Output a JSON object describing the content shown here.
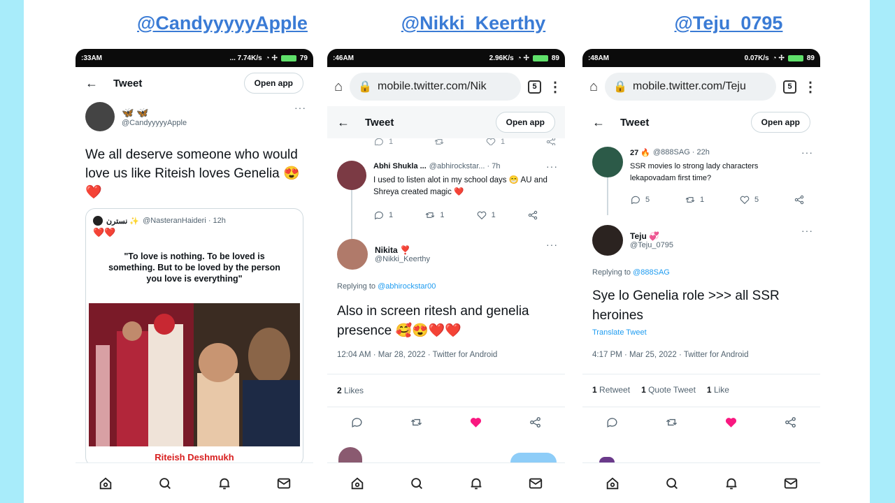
{
  "columns": [
    {
      "title": "@CandyyyyyApple",
      "status": {
        "time": ":33AM",
        "right": "... 7.74K/s",
        "battery": "79"
      },
      "header": {
        "title": "Tweet",
        "open_app": "Open app"
      },
      "author": {
        "name": "🦋 🦋",
        "handle": "@CandyyyyyApple"
      },
      "tweet_text": "We all deserve someone who would love us like Riteish loves Genelia 😍❤️",
      "quote": {
        "name": "نسترن ✨",
        "handle": "@NasteranHaideri · 12h",
        "hearts": "❤️❤️",
        "caption": "\"To love is nothing. To be loved is something. But to be loved by the person you love is everything\"",
        "footer": "Riteish Deshmukh"
      }
    },
    {
      "title": "@Nikki_Keerthy",
      "status": {
        "time": ":46AM",
        "right": "2.96K/s",
        "battery": "89"
      },
      "url": "mobile.twitter.com/Nik",
      "tab_count": "5",
      "header": {
        "title": "Tweet",
        "open_app": "Open app"
      },
      "prev_counts": [
        "1",
        "",
        "1",
        ""
      ],
      "reply": {
        "name": "Abhi Shukla ...",
        "handle": "@abhirockstar... · 7h",
        "text": "I used to listen alot in my school days 😁 AU and Shreya created magic ❤️",
        "counts": [
          "1",
          "1",
          "1"
        ]
      },
      "author": {
        "name": "Nikita ❣️",
        "handle": "@Nikki_Keerthy"
      },
      "replying_label": "Replying to ",
      "replying_to": "@abhirockstar00",
      "tweet_text": "Also in screen ritesh and genelia presence 🥰😍❤️❤️",
      "timestamp": "12:04 AM · Mar 28, 2022 · Twitter for Android",
      "stats": {
        "likes_count": "2",
        "likes_label": "Likes"
      }
    },
    {
      "title": "@Teju_0795",
      "status": {
        "time": ":48AM",
        "right": "0.07K/s",
        "battery": "89"
      },
      "url": "mobile.twitter.com/Teju",
      "tab_count": "5",
      "header": {
        "title": "Tweet",
        "open_app": "Open app"
      },
      "reply": {
        "name": "27 🔥",
        "handle": "@888SAG · 22h",
        "text": "SSR movies lo strong lady characters lekapovadam first time?",
        "counts": [
          "5",
          "1",
          "5"
        ]
      },
      "author": {
        "name": "Teju 💞",
        "handle": "@Teju_0795"
      },
      "replying_label": "Replying to ",
      "replying_to": "@888SAG",
      "tweet_text": "Sye lo Genelia role >>> all SSR heroines",
      "translate": "Translate Tweet",
      "timestamp": "4:17 PM · Mar 25, 2022 · Twitter for Android",
      "stats": {
        "retweets_count": "1",
        "retweets_label": "Retweet",
        "quotes_count": "1",
        "quotes_label": "Quote Tweet",
        "likes_count": "1",
        "likes_label": "Like"
      }
    }
  ],
  "colors": {
    "background": "#a8ecfa",
    "link": "#1d9bf0",
    "heart": "#f91880",
    "title": "#3a7bd5"
  }
}
